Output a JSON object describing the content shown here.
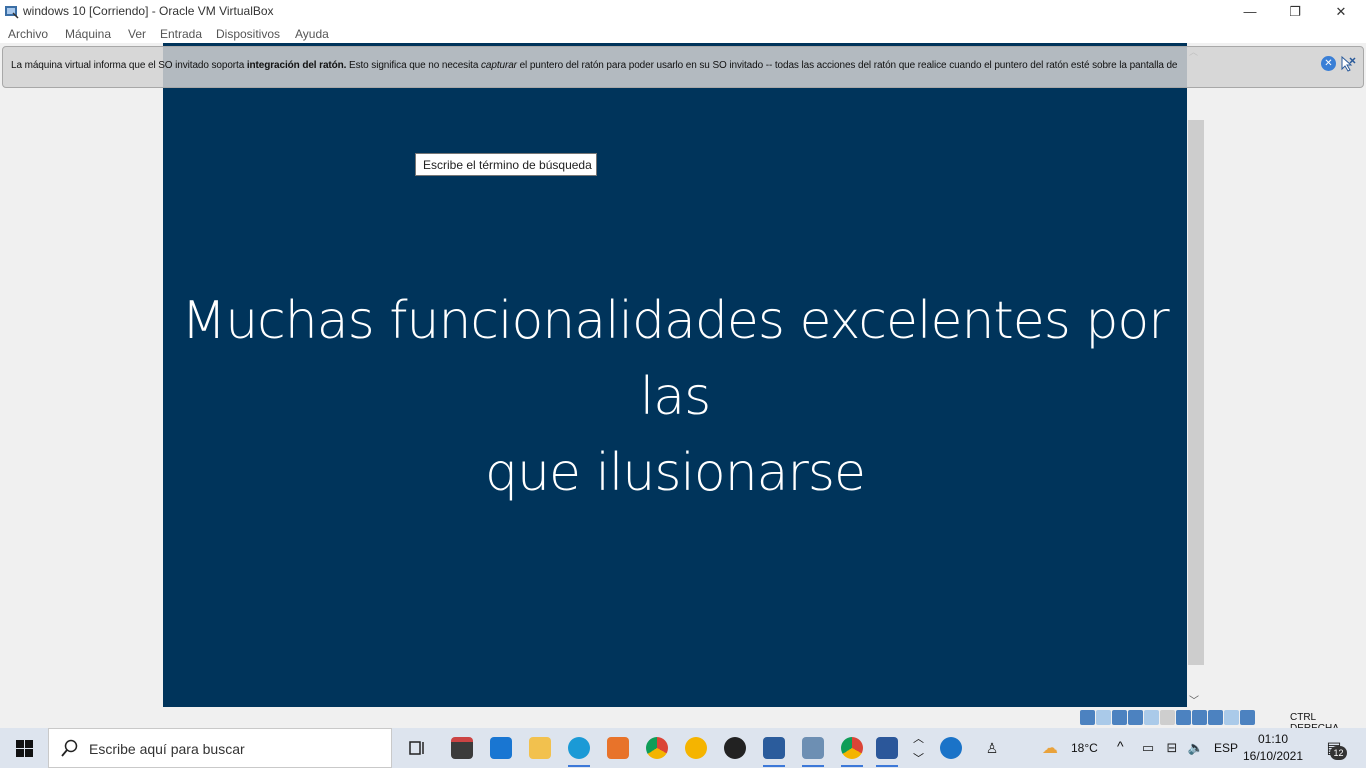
{
  "window": {
    "title": "windows 10 [Corriendo] - Oracle VM VirtualBox",
    "controls": {
      "minimize": "—",
      "restore": "❐",
      "close": "✕"
    }
  },
  "menu": [
    "Archivo",
    "Máquina",
    "Ver",
    "Entrada",
    "Dispositivos",
    "Ayuda"
  ],
  "notification": {
    "part1": "La máquina virtual informa que el SO invitado soporta ",
    "bold": "integración del ratón.",
    "part2": " Esto significa que no necesita ",
    "italic": "capturar",
    "part3": " el puntero del ratón para poder usarlo en su SO invitado -- todas las acciones del ratón que realice cuando el puntero del ratón esté sobre la pantalla de"
  },
  "guest": {
    "tooltip": "Escribe el término de búsqueda",
    "headline_line1": "Muchas funcionalidades excelentes por las",
    "headline_line2": "que ilusionarse",
    "background_color": "#00345b"
  },
  "statusbar": {
    "host_key": "CTRL DERECHA"
  },
  "taskbar": {
    "search_placeholder": "Escribe aquí para buscar",
    "apps": [
      "task-view",
      "store",
      "mail",
      "file-explorer",
      "edge",
      "app-orange",
      "chrome",
      "vpn-app",
      "obs",
      "virtualbox",
      "vm-window",
      "chrome-profile",
      "word"
    ],
    "weather": "18°C",
    "language": "ESP",
    "time": "01:10",
    "date": "16/10/2021",
    "notifications_count": "12"
  }
}
